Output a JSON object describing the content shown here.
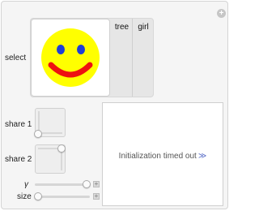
{
  "controls": {
    "select": {
      "label": "select",
      "options": [
        "tree",
        "girl"
      ]
    },
    "share1": {
      "label": "share 1"
    },
    "share2": {
      "label": "share 2"
    },
    "gamma": {
      "label": "γ",
      "value_fraction": 0.92
    },
    "size": {
      "label": "size",
      "value_fraction": 0.05
    }
  },
  "output": {
    "message": "Initialization timed out",
    "more_glyph": "≫"
  },
  "icons": {
    "corner": "plus-circle-icon",
    "selected_option": "smiley-face-icon"
  },
  "colors": {
    "smiley_face": "#ffff00",
    "smiley_eyes": "#1f3fd6",
    "smiley_mouth": "#ee1111"
  }
}
